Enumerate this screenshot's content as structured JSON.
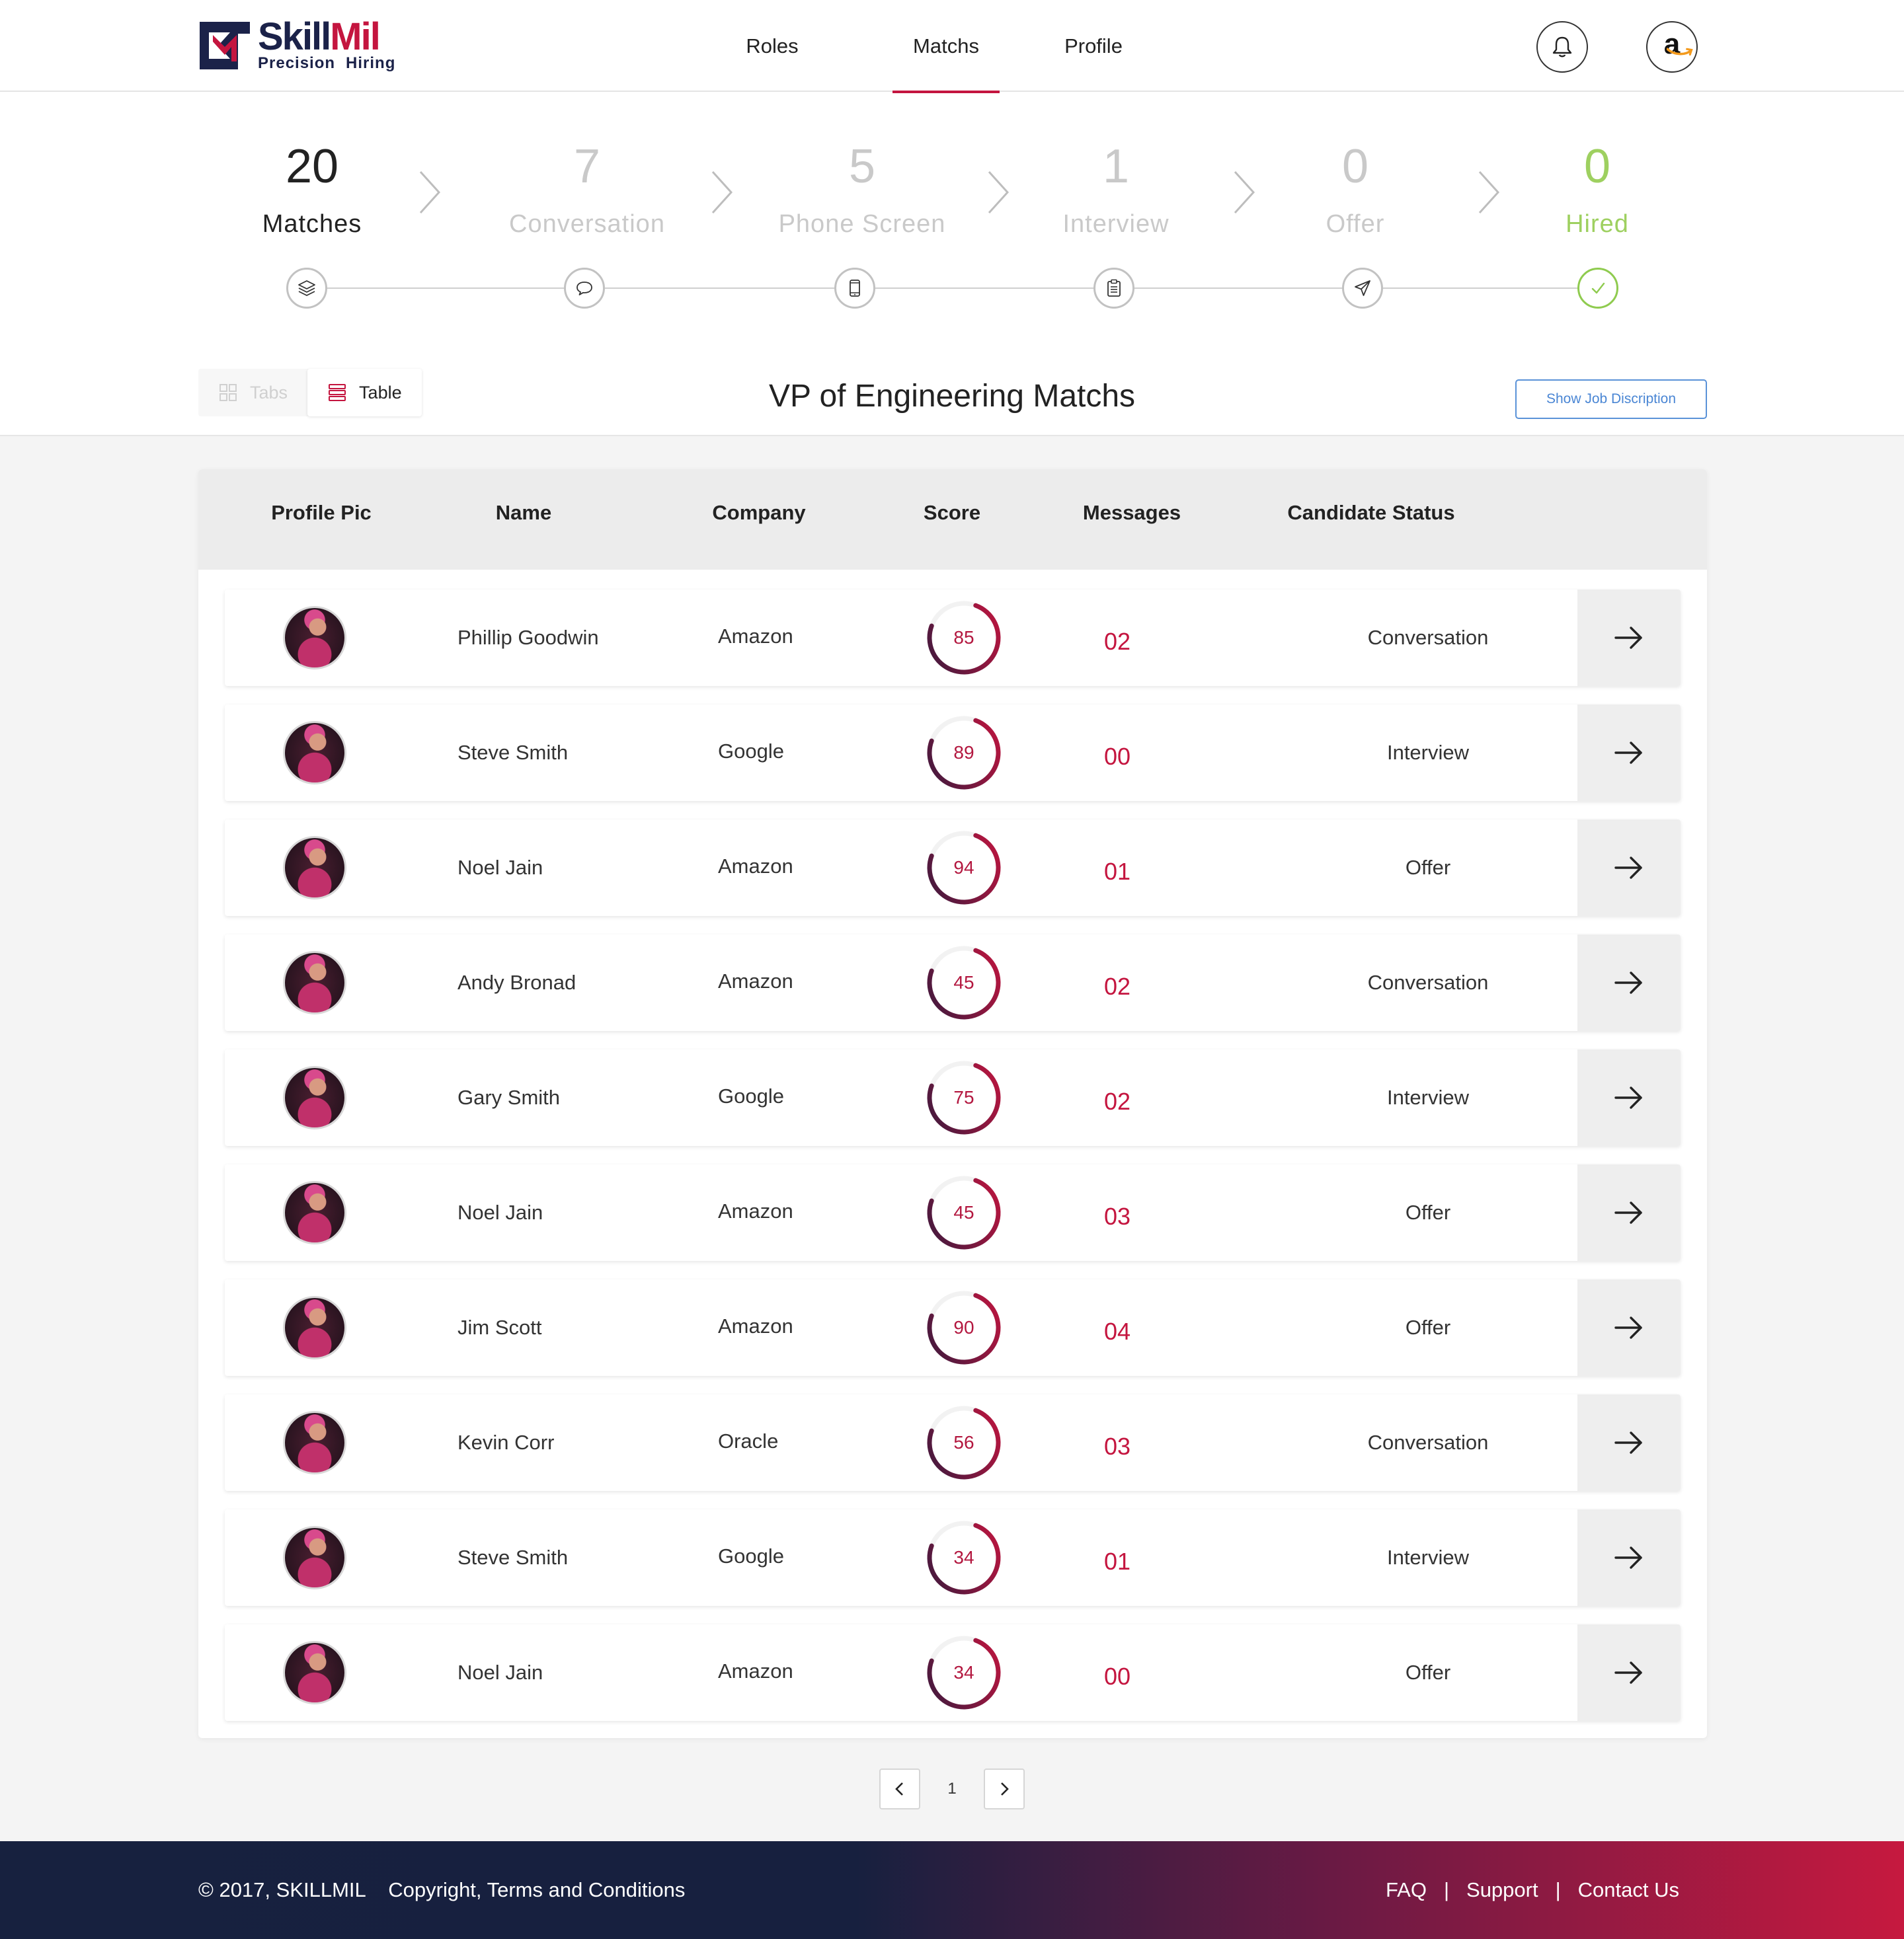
{
  "brand": {
    "name_part1": "Skill",
    "name_part2": "Mil",
    "tagline_1": "Precision",
    "tagline_2": "Hiring",
    "colors": {
      "navy": "#1b2249",
      "red": "#c4153f"
    }
  },
  "nav": {
    "items": [
      {
        "label": "Roles"
      },
      {
        "label": "Matchs",
        "active": true
      },
      {
        "label": "Profile"
      }
    ]
  },
  "header_icons": {
    "notifications": "bell-icon",
    "account": "amazon-logo",
    "account_letter": "a"
  },
  "pipeline": [
    {
      "count": "20",
      "label": "Matches",
      "icon": "layers-icon",
      "state": "current"
    },
    {
      "count": "7",
      "label": "Conversation",
      "icon": "chat-bubble-icon",
      "state": "pending"
    },
    {
      "count": "5",
      "label": "Phone Screen",
      "icon": "phone-icon",
      "state": "pending"
    },
    {
      "count": "1",
      "label": "Interview",
      "icon": "clipboard-icon",
      "state": "pending"
    },
    {
      "count": "0",
      "label": "Offer",
      "icon": "send-icon",
      "state": "pending"
    },
    {
      "count": "0",
      "label": "Hired",
      "icon": "check-icon",
      "state": "done"
    }
  ],
  "view_toggle": {
    "tabs_label": "Tabs",
    "table_label": "Table",
    "selected": "Table"
  },
  "page_title": "VP of Engineering Matchs",
  "job_description_button": "Show Job Discription",
  "table": {
    "headers": [
      "Profile Pic",
      "Name",
      "Company",
      "Score",
      "Messages",
      "Candidate Status"
    ],
    "rows": [
      {
        "name": "Phillip Goodwin",
        "company": "Amazon",
        "score": "85",
        "messages": "02",
        "status": "Conversation"
      },
      {
        "name": "Steve Smith",
        "company": "Google",
        "score": "89",
        "messages": "00",
        "status": "Interview"
      },
      {
        "name": "Noel Jain",
        "company": "Amazon",
        "score": "94",
        "messages": "01",
        "status": "Offer"
      },
      {
        "name": "Andy Bronad",
        "company": "Amazon",
        "score": "45",
        "messages": "02",
        "status": "Conversation"
      },
      {
        "name": "Gary Smith",
        "company": "Google",
        "score": "75",
        "messages": "02",
        "status": "Interview"
      },
      {
        "name": "Noel Jain",
        "company": "Amazon",
        "score": "45",
        "messages": "03",
        "status": "Offer"
      },
      {
        "name": "Jim Scott",
        "company": "Amazon",
        "score": "90",
        "messages": "04",
        "status": "Offer"
      },
      {
        "name": "Kevin Corr",
        "company": "Oracle",
        "score": "56",
        "messages": "03",
        "status": "Conversation"
      },
      {
        "name": "Steve Smith",
        "company": "Google",
        "score": "34",
        "messages": "01",
        "status": "Interview"
      },
      {
        "name": "Noel Jain",
        "company": "Amazon",
        "score": "34",
        "messages": "00",
        "status": "Offer"
      }
    ]
  },
  "pagination": {
    "current_page": "1"
  },
  "footer": {
    "copyright": "© 2017, SKILLMIL",
    "terms": "Copyright, Terms and Conditions",
    "links": [
      "FAQ",
      "Support",
      "Contact Us"
    ],
    "separator": "|"
  }
}
